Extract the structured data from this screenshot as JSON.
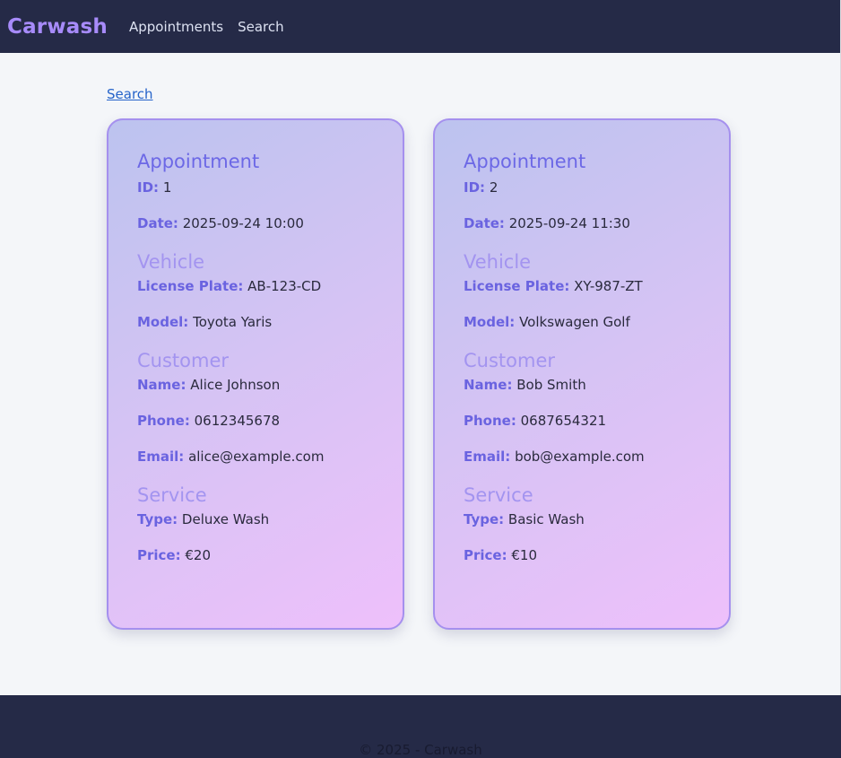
{
  "nav": {
    "brand": "Carwash",
    "links": [
      "Appointments",
      "Search"
    ]
  },
  "back_link": "Search",
  "labels": {
    "appointment": "Appointment",
    "vehicle": "Vehicle",
    "customer": "Customer",
    "service": "Service",
    "id": "ID:",
    "date": "Date:",
    "plate": "License Plate:",
    "model": "Model:",
    "name": "Name:",
    "phone": "Phone:",
    "email": "Email:",
    "type": "Type:",
    "price": "Price:"
  },
  "appointments": [
    {
      "id": "1",
      "date": "2025-09-24 10:00",
      "plate": "AB-123-CD",
      "model": "Toyota Yaris",
      "name": "Alice Johnson",
      "phone": "0612345678",
      "email": "alice@example.com",
      "type": "Deluxe Wash",
      "price": "€20"
    },
    {
      "id": "2",
      "date": "2025-09-24 11:30",
      "plate": "XY-987-ZT",
      "model": "Volkswagen Golf",
      "name": "Bob Smith",
      "phone": "0687654321",
      "email": "bob@example.com",
      "type": "Basic Wash",
      "price": "€10"
    }
  ],
  "footer": "© 2025 - Carwash",
  "colors": {
    "nav_bg": "#252a47",
    "brand": "#a78bfa",
    "accent": "#6a63e0",
    "link": "#2563c9"
  }
}
